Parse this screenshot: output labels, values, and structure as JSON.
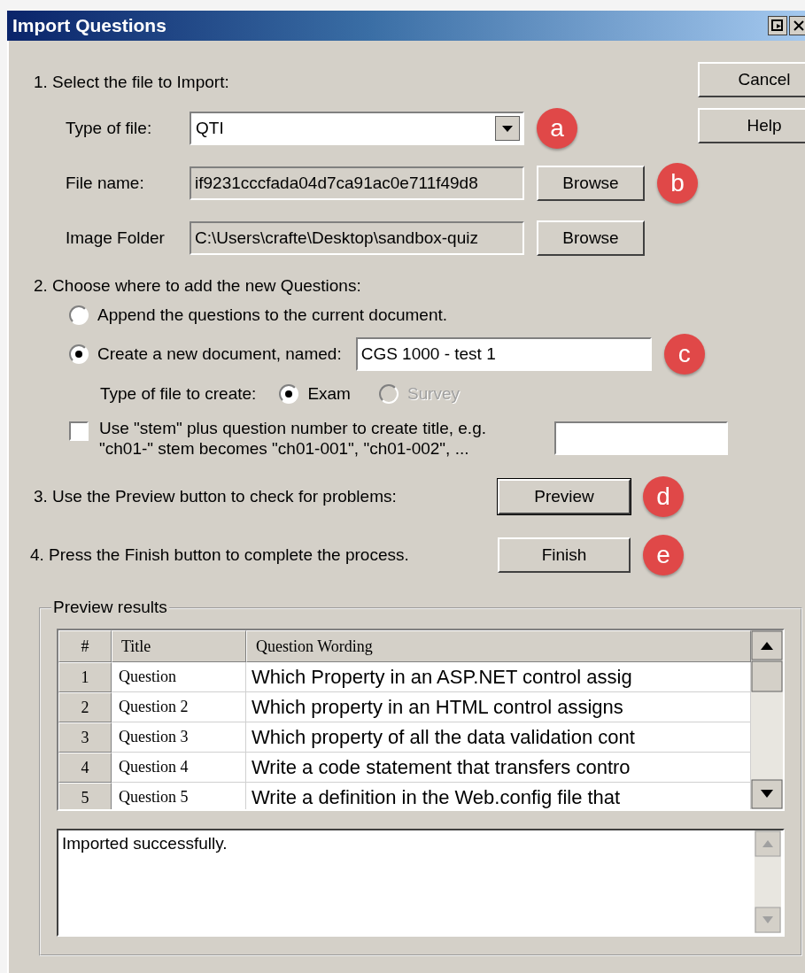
{
  "window": {
    "title": "Import Questions"
  },
  "buttons": [
    {
      "label": "Cancel"
    },
    {
      "label": "Help"
    }
  ],
  "step1": {
    "heading": "1.  Select the file to Import:",
    "type_of_file": {
      "label": "Type of file:",
      "value": "QTI",
      "callout": "a"
    },
    "file_name": {
      "label": "File name:",
      "value": "if9231cccfada04d7ca91ac0e711f49d8",
      "button": "Browse",
      "callout": "b"
    },
    "image_folder": {
      "label": "Image Folder",
      "value": "C:\\Users\\crafte\\Desktop\\sandbox-quiz",
      "button": "Browse"
    }
  },
  "step2": {
    "heading": "2.  Choose where to add the new Questions:",
    "options": [
      {
        "label": "Append the questions to the current document.",
        "selected": false
      },
      {
        "label": "Create a new document, named:",
        "selected": true
      }
    ],
    "document_name": {
      "value": "CGS 1000 - test 1",
      "callout": "c"
    },
    "file_type": {
      "label": "Type of file to create:",
      "options": [
        {
          "label": "Exam",
          "selected": true,
          "disabled": false
        },
        {
          "label": "Survey",
          "selected": false,
          "disabled": true
        }
      ]
    },
    "stem": {
      "checked": false,
      "text": "Use \"stem\" plus question number to create title,  e.g.\n\"ch01-\" stem becomes \"ch01-001\",  \"ch01-002\",  ..."
    }
  },
  "step3": {
    "text": "3.  Use the Preview button to check for problems:",
    "button": "Preview",
    "callout": "d"
  },
  "step4": {
    "text": "4.  Press the Finish button to complete the process.",
    "button": "Finish",
    "callout": "e"
  },
  "preview": {
    "legend": "Preview results",
    "columns": [
      "#",
      "Title",
      "Question Wording"
    ],
    "rows": [
      {
        "number": "1",
        "title": "Question",
        "wording": "Which Property in an ASP.NET control assig"
      },
      {
        "number": "2",
        "title": "Question 2",
        "wording": "Which property in an HTML control assigns"
      },
      {
        "number": "3",
        "title": "Question 3",
        "wording": "Which property of all the data validation cont"
      },
      {
        "number": "4",
        "title": "Question 4",
        "wording": "Write a code statement that transfers contro"
      },
      {
        "number": "5",
        "title": "Question 5",
        "wording": "Write a definition in the Web.config file that"
      }
    ],
    "log": "Imported successfully."
  }
}
